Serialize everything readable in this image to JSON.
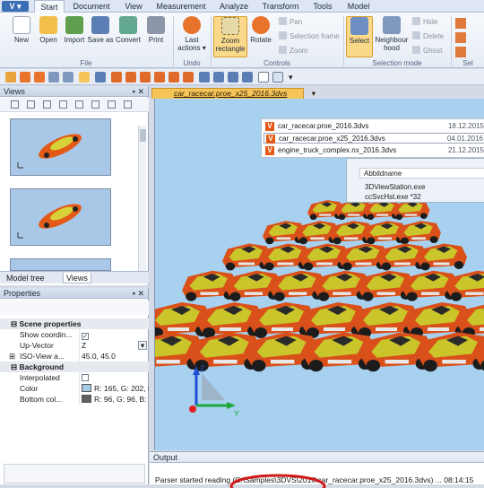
{
  "app": {
    "logo": "V"
  },
  "tabs": [
    "Start",
    "Document",
    "View",
    "Measurement",
    "Analyze",
    "Transform",
    "Tools",
    "Model"
  ],
  "ribbon": {
    "file_buttons": [
      "New",
      "Open",
      "Import",
      "Save as",
      "Convert",
      "Print"
    ],
    "file_group": "File",
    "undo_button": "Last actions ▾",
    "undo_group": "Undo",
    "zoom_button": "Zoom rectangle",
    "rotate_button": "Rotate",
    "controls_small": [
      "Pan",
      "Selection frame",
      "Zoom"
    ],
    "controls_group": "Controls",
    "select_button": "Select",
    "neighbourhood_button": "Neighbour hood",
    "selmode_small": [
      "Hide",
      "Delete",
      "Ghost"
    ],
    "selmode_group": "Selection mode",
    "cut_group": "Sel"
  },
  "views_panel": {
    "title": "Views"
  },
  "panel_tabs": {
    "model_tree": "Model tree",
    "views": "Views"
  },
  "properties": {
    "title": "Properties",
    "rows": [
      {
        "type": "header",
        "label": "Scene properties"
      },
      {
        "type": "row",
        "key": "Show coordin...",
        "check": "✓"
      },
      {
        "type": "row",
        "key": "Up-Vector",
        "value": "Z",
        "dropdown": "▾"
      },
      {
        "type": "row",
        "key": "ISO-View a...",
        "value": "45.0, 45.0",
        "expand": "⊞"
      },
      {
        "type": "header",
        "label": "Background"
      },
      {
        "type": "row",
        "key": "Interpolated",
        "check": ""
      },
      {
        "type": "row",
        "key": "Color",
        "value": "R: 165, G: 202, B:",
        "swatch": "#a5cae6"
      },
      {
        "type": "row",
        "key": "Bottom col...",
        "value": "R: 96, G: 96, B: 96",
        "swatch": "#606060"
      }
    ]
  },
  "document": {
    "tab_label": "car_racecar.proe_x25_2016.3dvs"
  },
  "recent_files": [
    {
      "name": "car_racecar.proe_2016.3dvs",
      "date": "18.12.2015"
    },
    {
      "name": "car_racecar.proe_x25_2016.3dvs",
      "date": "04.01.2016"
    },
    {
      "name": "engine_truck_complex.nx_2016.3dvs",
      "date": "21.12.2015"
    }
  ],
  "task_window": {
    "header": "Abbildname",
    "items": [
      "3DViewStation.exe",
      "ccSvcHst.exe *32"
    ]
  },
  "axes": {
    "z": "Z",
    "y": "Y"
  },
  "output": {
    "title": "Output",
    "message": "Parser started reading (C:\\Samples\\3DVS\\2016\\car_racecar.proe_x25_2016.3dvs) ... 08:14:15"
  }
}
